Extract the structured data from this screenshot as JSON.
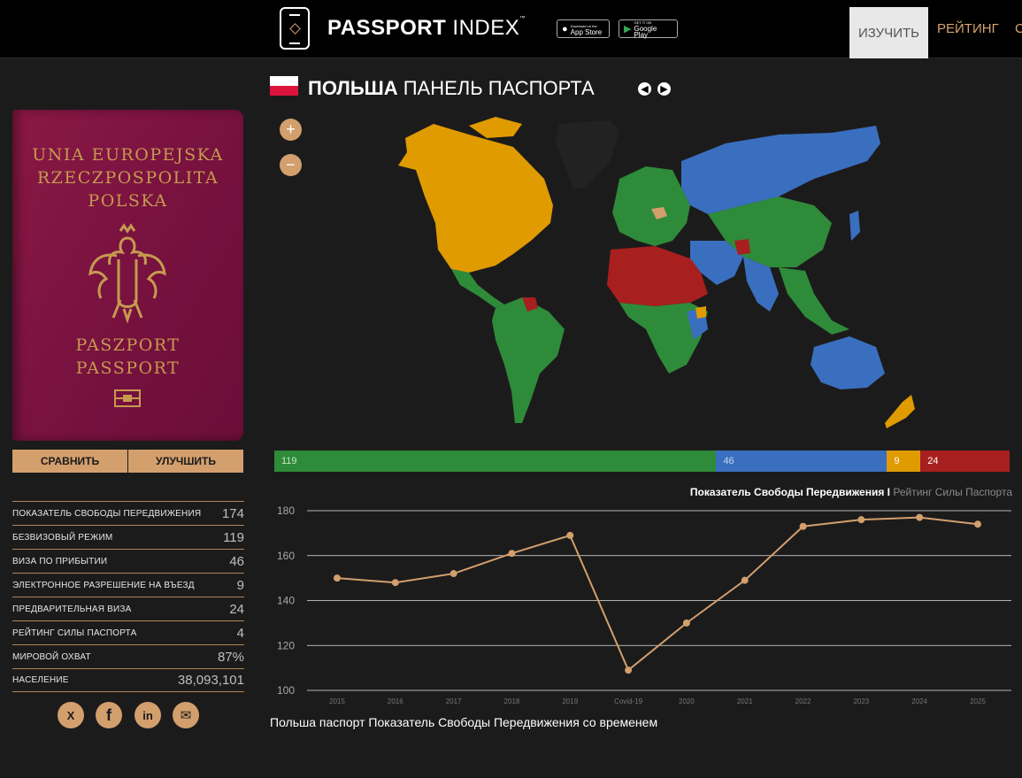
{
  "header": {
    "brand_bold": "PASSPORT",
    "brand_light": " INDEX",
    "brand_tm": "™",
    "app_store_label": "App Store",
    "app_store_small": "Download on the",
    "google_play_label": "Google Play",
    "google_play_small": "GET IT ON",
    "nav": {
      "explore": "ИЗУЧИТЬ",
      "rank": "РЕЙТИНГ",
      "more": "С"
    }
  },
  "country": {
    "name": "ПОЛЬША",
    "dashboard": " ПАНЕЛЬ ПАСПОРТА"
  },
  "passport_cover": {
    "line1": "UNIA EUROPEJSKA",
    "line2": "RZECZPOSPOLITA",
    "line3": "POLSKA",
    "line4": "PASZPORT",
    "line5": "PASSPORT"
  },
  "buttons": {
    "compare": "СРАВНИТЬ",
    "improve": "УЛУЧШИТЬ"
  },
  "stats": [
    {
      "label": "ПОКАЗАТЕЛЬ СВОБОДЫ ПЕРЕДВИЖЕНИЯ",
      "value": "174"
    },
    {
      "label": "БЕЗВИЗОВЫЙ РЕЖИМ",
      "value": "119"
    },
    {
      "label": "ВИЗА ПО ПРИБЫТИИ",
      "value": "46"
    },
    {
      "label": "ЭЛЕКТРОННОЕ РАЗРЕШЕНИЕ НА ВЪЕЗД",
      "value": "9"
    },
    {
      "label": "ПРЕДВАРИТЕЛЬНАЯ ВИЗА",
      "value": "24"
    },
    {
      "label": "РЕЙТИНГ СИЛЫ ПАСПОРТА",
      "value": "4"
    },
    {
      "label": "МИРОВОЙ ОХВАТ",
      "value": "87%"
    },
    {
      "label": "НАСЕЛЕНИЕ",
      "value": "38,093,101"
    }
  ],
  "social": {
    "x": "X",
    "facebook": "f",
    "linkedin": "in",
    "email": "✉"
  },
  "zoom": {
    "in": "+",
    "out": "−"
  },
  "nav_arrows": {
    "prev": "◀",
    "next": "▶"
  },
  "colors": {
    "visa_free": "#2e8b3a",
    "visa_on_arrival": "#3a6fbf",
    "eta": "#e09b00",
    "visa_required": "#a81f1f",
    "self": "#d29f6d",
    "accent": "#d29f6d"
  },
  "access_bar": [
    {
      "key": "visa_free",
      "value": 119
    },
    {
      "key": "visa_on_arrival",
      "value": 46
    },
    {
      "key": "eta",
      "value": 9
    },
    {
      "key": "visa_required",
      "value": 24
    }
  ],
  "chart_tabs": {
    "active": "Показатель Свободы Передвижения",
    "sep": " I ",
    "inactive": "Рейтинг Силы Паспорта"
  },
  "chart_data": {
    "type": "line",
    "categories": [
      "2015",
      "2016",
      "2017",
      "2018",
      "2019",
      "Covid-19",
      "2020",
      "2021",
      "2022",
      "2023",
      "2024",
      "2025"
    ],
    "values": [
      150,
      148,
      152,
      161,
      169,
      109,
      130,
      149,
      173,
      176,
      177,
      174
    ],
    "yticks": [
      100,
      120,
      140,
      160,
      180
    ],
    "ylim": [
      100,
      180
    ],
    "line_color": "#d29f6d",
    "grid": true
  },
  "caption": "Польша паспорт Показатель Свободы Передвижения со временем"
}
